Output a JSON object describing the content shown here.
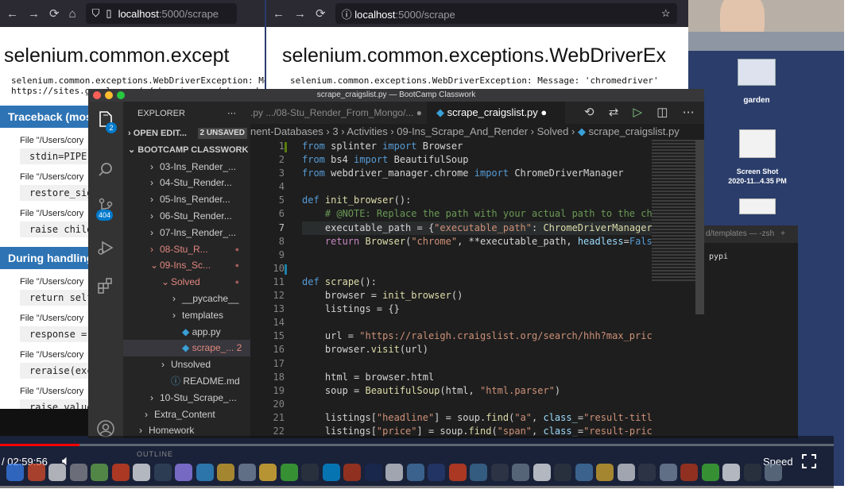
{
  "left_browser": {
    "url_prefix": "localhost",
    "url_path": ":5000/scrape",
    "heading": "selenium.common.except",
    "message_lines": [
      "selenium.common.exceptions.WebDriverException: Me",
      "https://sites.google.com/a/chromium.org/chromedri"
    ],
    "traceback_label": "Traceback (most",
    "frames": [
      {
        "file": "File \"/Users/cory",
        "code": "stdin=PIPE)"
      },
      {
        "file": "File \"/Users/cory",
        "code": "restore_sig"
      },
      {
        "file": "File \"/Users/cory",
        "code": "raise child"
      }
    ],
    "during_label": "During handling",
    "frames2": [
      {
        "file": "File \"/Users/cory",
        "code": "return self"
      },
      {
        "file": "File \"/Users/cory",
        "code": "response ="
      },
      {
        "file": "File \"/Users/cory",
        "code": "reraise(exc"
      },
      {
        "file": "File \"/Users/cory",
        "code": "raise_value"
      }
    ]
  },
  "right_browser": {
    "url_prefix": "localhost",
    "url_path": ":5000/scrape",
    "heading": "selenium.common.exceptions.WebDriverEx",
    "message": "selenium.common.exceptions.WebDriverException: Message: 'chromedriver'"
  },
  "desktop": {
    "icons": [
      {
        "label": "garden"
      },
      {
        "label": "Screen Shot",
        "label2": "2020-11...4.35 PM"
      }
    ]
  },
  "vscode": {
    "window_title": "scrape_craigslist.py — BootCamp Classwork",
    "explorer_label": "EXPLORER",
    "open_editors": "OPEN EDIT...",
    "unsaved": "2 UNSAVED",
    "workspace": "BOOTCAMP CLASSWORK",
    "tree": [
      {
        "label": "03-Ins_Render_...",
        "indent": 1,
        "chev": "›"
      },
      {
        "label": "04-Stu_Render...",
        "indent": 1,
        "chev": "›"
      },
      {
        "label": "05-Ins_Render...",
        "indent": 1,
        "chev": "›"
      },
      {
        "label": "06-Stu_Render...",
        "indent": 1,
        "chev": "›"
      },
      {
        "label": "07-Ins_Render_...",
        "indent": 1,
        "chev": "›"
      },
      {
        "label": "08-Stu_R...",
        "indent": 1,
        "chev": "›",
        "modified": true
      },
      {
        "label": "09-Ins_Sc...",
        "indent": 1,
        "chev": "⌄",
        "modified": true
      },
      {
        "label": "Solved",
        "indent": 2,
        "chev": "⌄",
        "modified": true
      },
      {
        "label": "__pycache__",
        "indent": 3,
        "chev": "›"
      },
      {
        "label": "templates",
        "indent": 3,
        "chev": "›"
      },
      {
        "label": "app.py",
        "indent": 3,
        "chev": "",
        "py": true
      },
      {
        "label": "scrape_... 2",
        "indent": 3,
        "chev": "",
        "py": true,
        "modified": true,
        "selected": true
      },
      {
        "label": "Unsolved",
        "indent": 2,
        "chev": "›"
      },
      {
        "label": "README.md",
        "indent": 2,
        "chev": "",
        "info": true
      },
      {
        "label": "10-Stu_Scrape_...",
        "indent": 1,
        "chev": "›"
      },
      {
        "label": "Extra_Content",
        "indent": 0.5,
        "chev": "›"
      },
      {
        "label": "Homework",
        "indent": 0,
        "chev": "›"
      }
    ],
    "inactive_tab": ".py .../08-Stu_Render_From_Mongo/...",
    "active_tab": "scrape_craigslist.py",
    "breadcrumb": [
      "nent-Databases",
      "3",
      "Activities",
      "09-Ins_Scrape_And_Render",
      "Solved",
      "scrape_craigslist.py"
    ],
    "source_badge": "2",
    "problems_badge": "404"
  },
  "terminal": {
    "tab_label": "d/templates — -zsh",
    "line": "pypi"
  },
  "video": {
    "time": "/ 02:59:56",
    "speed_label": "Speed",
    "outline_label": "OUTLINE"
  },
  "colors": {
    "accent": "#007acc",
    "modified": "#e2877d",
    "traceback_blue": "#2e74b5"
  }
}
